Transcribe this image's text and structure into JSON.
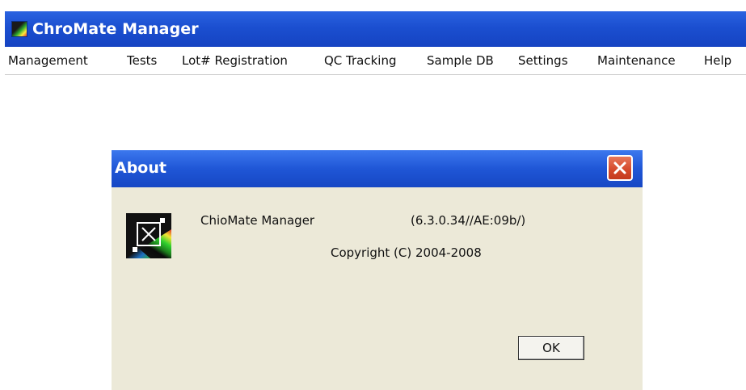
{
  "app": {
    "title": "ChroMate Manager",
    "icon": "app-logo-icon"
  },
  "menubar": {
    "items": [
      {
        "label": "Management"
      },
      {
        "label": "Tests"
      },
      {
        "label": "Lot# Registration"
      },
      {
        "label": "QC Tracking"
      },
      {
        "label": "Sample DB"
      },
      {
        "label": "Settings"
      },
      {
        "label": "Maintenance"
      },
      {
        "label": "Help"
      }
    ]
  },
  "dialog": {
    "title": "About",
    "close_icon": "close-icon",
    "product_name": "ChioMate Manager",
    "version": "(6.3.0.34//AE:09b/)",
    "copyright": "Copyright (C) 2004-2008",
    "ok_label": "OK"
  },
  "colors": {
    "titlebar_blue": "#1b4fd0",
    "dialog_bg": "#ece9d8",
    "close_red": "#d4482a"
  }
}
